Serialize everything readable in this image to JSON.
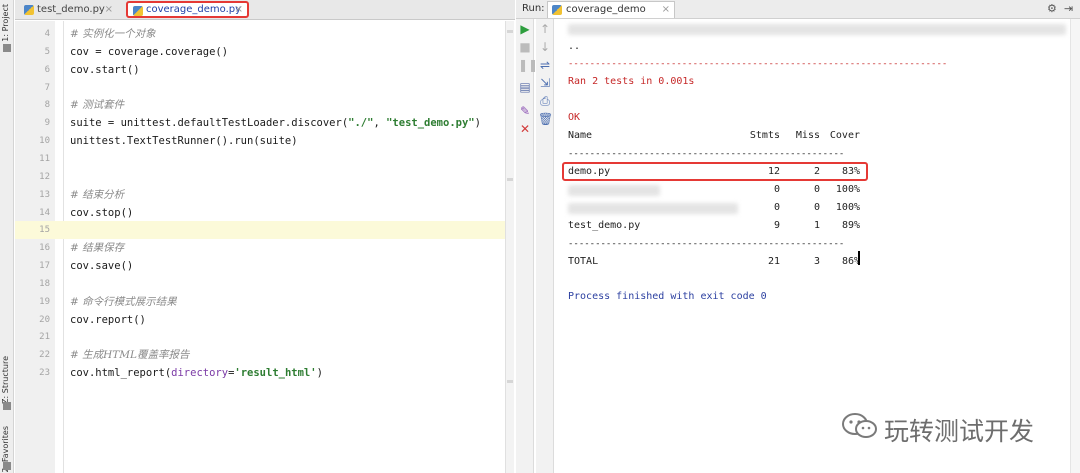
{
  "side_strip": {
    "project_tab": "1: Project",
    "structure_tab": "Z: Structure",
    "favorites_tab": "2: Favorites"
  },
  "editor": {
    "tabs": [
      {
        "label": "test_demo.py",
        "icon": "python-file-icon"
      },
      {
        "label": "coverage_demo.py",
        "icon": "python-file-icon",
        "active": true
      }
    ],
    "current_line": 15,
    "lines": [
      {
        "num": "4",
        "comment": "# 实例化一个对象"
      },
      {
        "num": "5",
        "text": "cov = coverage.coverage()"
      },
      {
        "num": "6",
        "text": "cov.start()"
      },
      {
        "num": "7",
        "text": ""
      },
      {
        "num": "8",
        "comment": "# 测试套件"
      },
      {
        "num": "9",
        "pre": "suite = unittest.defaultTestLoader.discover(",
        "s1": "\"./\"",
        "mid": ", ",
        "s2": "\"test_demo.py\"",
        "post": ")"
      },
      {
        "num": "10",
        "text": "unittest.TextTestRunner().run(suite)"
      },
      {
        "num": "11",
        "text": ""
      },
      {
        "num": "12",
        "text": ""
      },
      {
        "num": "13",
        "comment": "# 结束分析"
      },
      {
        "num": "14",
        "text": "cov.stop()"
      },
      {
        "num": "15",
        "text": ""
      },
      {
        "num": "16",
        "comment": "# 结果保存"
      },
      {
        "num": "17",
        "text": "cov.save()"
      },
      {
        "num": "18",
        "text": ""
      },
      {
        "num": "19",
        "comment": "# 命令行模式展示结果"
      },
      {
        "num": "20",
        "text": "cov.report()"
      },
      {
        "num": "21",
        "text": ""
      },
      {
        "num": "22",
        "comment": "# 生成HTML覆盖率报告"
      },
      {
        "num": "23",
        "pre": "cov.html_report(",
        "kw": "directory",
        "eq": "=",
        "s1": "'result_html'",
        "post": ")"
      }
    ]
  },
  "run": {
    "label": "Run:",
    "tab_label": "coverage_demo",
    "header_icons": [
      "gear-icon",
      "minimize-icon"
    ],
    "dots": "..",
    "separator": "----------------------------------------------------------------------",
    "ran": "Ran 2 tests in 0.001s",
    "ok": "OK",
    "table": {
      "headers": [
        "Name",
        "Stmts",
        "Miss",
        "Cover"
      ],
      "divider": "---------------------------------------------------",
      "rows": [
        {
          "name": "demo.py",
          "stmts": "12",
          "miss": "2",
          "cover": "83%",
          "highlighted": true
        },
        {
          "name": "",
          "stmts": "0",
          "miss": "0",
          "cover": "100%",
          "blurred": true
        },
        {
          "name": "",
          "stmts": "0",
          "miss": "0",
          "cover": "100%",
          "blurred": true
        },
        {
          "name": "test_demo.py",
          "stmts": "9",
          "miss": "1",
          "cover": "89%"
        }
      ],
      "total": {
        "name": "TOTAL",
        "stmts": "21",
        "miss": "3",
        "cover": "86%"
      }
    },
    "finished": "Process finished with exit code 0"
  },
  "watermark": {
    "text": "玩转测试开发",
    "icon": "wechat-logo-icon"
  },
  "colors": {
    "highlight": "#e53935",
    "error_red": "#c62828",
    "process_blue": "#2b3fa0",
    "run_green": "#2e9e3e"
  }
}
